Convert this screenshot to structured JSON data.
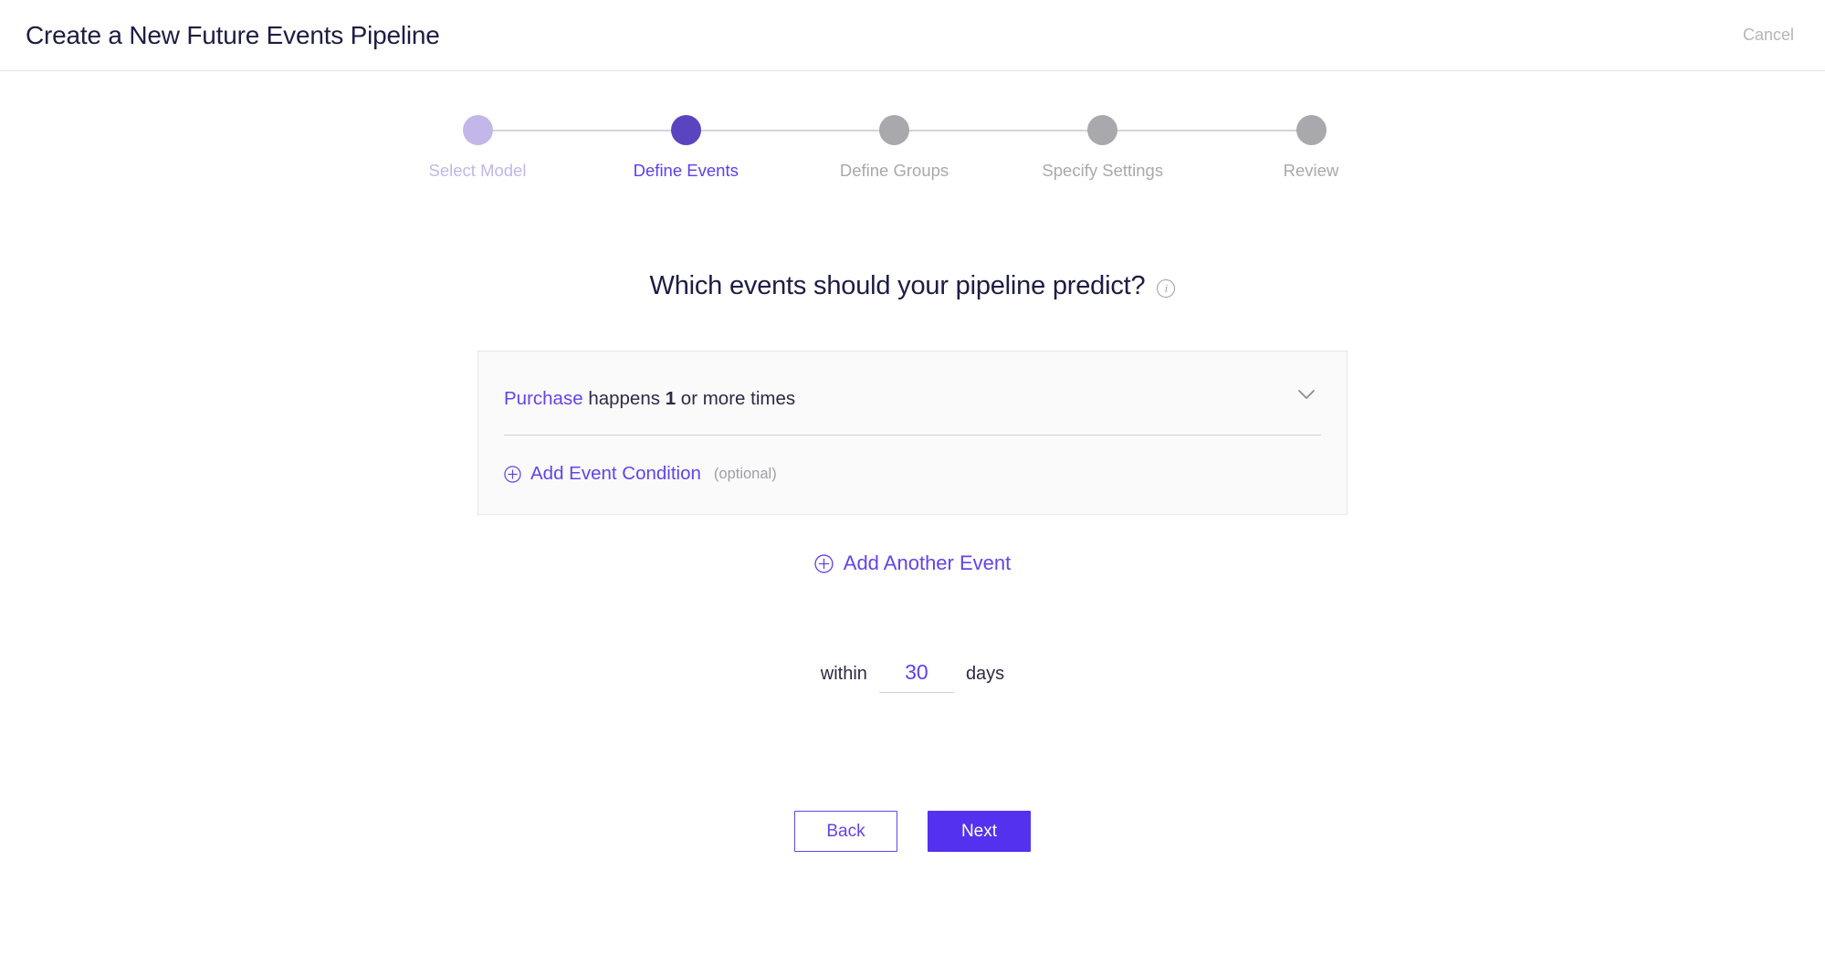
{
  "header": {
    "title": "Create a New Future Events Pipeline",
    "cancel_label": "Cancel"
  },
  "stepper": {
    "steps": [
      {
        "label": "Select Model",
        "state": "done"
      },
      {
        "label": "Define Events",
        "state": "active"
      },
      {
        "label": "Define Groups",
        "state": "upcoming"
      },
      {
        "label": "Specify Settings",
        "state": "upcoming"
      },
      {
        "label": "Review",
        "state": "upcoming"
      }
    ]
  },
  "main": {
    "question": "Which events should your pipeline predict?",
    "info_icon": "info-icon",
    "event_card": {
      "condition": {
        "event_name": "Purchase",
        "predicate": "happens",
        "count": "1",
        "suffix": "or more times",
        "chevron_icon": "chevron-down-icon"
      },
      "add_condition_label": "Add Event Condition",
      "add_condition_optional": "(optional)",
      "plus_icon": "plus-circle-icon"
    },
    "add_another_event_label": "Add Another Event",
    "timeframe": {
      "prefix": "within",
      "value": "30",
      "placeholder": "30",
      "suffix": "days"
    }
  },
  "footer": {
    "back_label": "Back",
    "next_label": "Next"
  },
  "colors": {
    "accent_purple": "#6344e8",
    "accent_purple_strong": "#5431ee",
    "step_active": "#5b44c0",
    "step_done": "#c3b6e8",
    "step_upcoming": "#a8a8ad",
    "heading_navy": "#1d1d44",
    "muted_gray": "#a8a8ad",
    "card_bg": "#fafafb"
  }
}
